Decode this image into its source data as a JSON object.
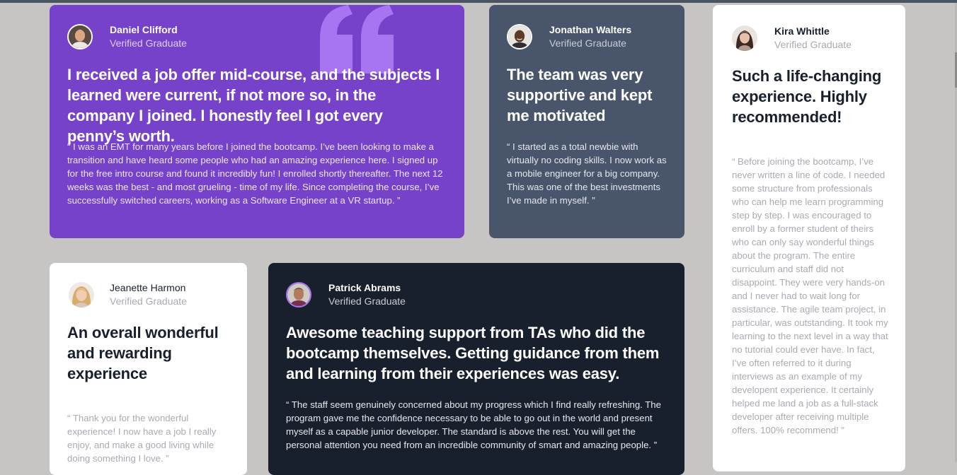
{
  "testimonials": [
    {
      "name": "Daniel Clifford",
      "status": "Verified Graduate",
      "headline": "I received a job offer mid-course, and the subjects I learned were current, if not more so, in the company I joined. I honestly feel I got every penny’s worth.",
      "text": "“ I was an EMT for many years before I joined the bootcamp. I’ve been looking to make a transition and have heard some people who had an amazing experience here. I signed up for the free intro course and found it incredibly fun! I enrolled shortly thereafter. The next 12 weeks was the best - and most grueling - time of my life. Since completing the course, I’ve successfully switched careers, working as a Software Engineer at a VR startup. ”",
      "avatar_icon": "man-portrait-avatar",
      "card_color": "#7542c9"
    },
    {
      "name": "Jonathan Walters",
      "status": "Verified Graduate",
      "headline": "The team was very supportive and kept me motivated",
      "text": "“ I started as a total newbie with virtually no coding skills. I now work as a mobile engineer for a big company. This was one of the best investments I’ve made in myself. ”",
      "avatar_icon": "smiling-man-avatar",
      "card_color": "#48556a"
    },
    {
      "name": "Kira Whittle",
      "status": "Verified Graduate",
      "headline": "Such a life-changing experience. Highly recommended!",
      "text": "“ Before joining the bootcamp, I’ve never written a line of code. I needed some structure from professionals who can help me learn programming step by step. I was encouraged to enroll by a former student of theirs who can only say wonderful things about the program. The entire curriculum and staff did not disappoint. They were very hands-on and I never had to wait long for assistance. The agile team project, in particular, was outstanding. It took my learning to the next level in a way that no tutorial could ever have. In fact, I’ve often referred to it during interviews as an example of my developent experience. It certainly helped me land a job as a full-stack developer after receiving multiple offers. 100% recommend! ”",
      "avatar_icon": "woman-dark-hair-avatar",
      "card_color": "#ffffff"
    },
    {
      "name": "Jeanette Harmon",
      "status": "Verified Graduate",
      "headline": "An overall wonderful and rewarding experience",
      "text": "“ Thank you for the wonderful experience! I now have a job I really enjoy, and make a good living while doing something I love. ”",
      "avatar_icon": "blonde-woman-avatar",
      "card_color": "#ffffff"
    },
    {
      "name": "Patrick Abrams",
      "status": "Verified Graduate",
      "headline": "Awesome teaching support from TAs who did the bootcamp themselves. Getting guidance from them and learning from their experiences was easy.",
      "text": "“ The staff seem genuinely concerned about my progress which I find really refreshing. The program gave me the confidence necessary to be able to go out in the world and present myself as a capable junior developer. The standard is above the rest. You will get the personal attention you need from an incredible community of smart and amazing people. ”",
      "avatar_icon": "man-purple-ring-avatar",
      "card_color": "#19202d"
    }
  ],
  "decoration": {
    "quote_icon": "quotation-mark-icon",
    "quote_color": "#a775f1"
  },
  "colors": {
    "page_background": "#c6c5c3",
    "accent_purple": "#7542c9",
    "ring_purple": "#a775f1"
  }
}
